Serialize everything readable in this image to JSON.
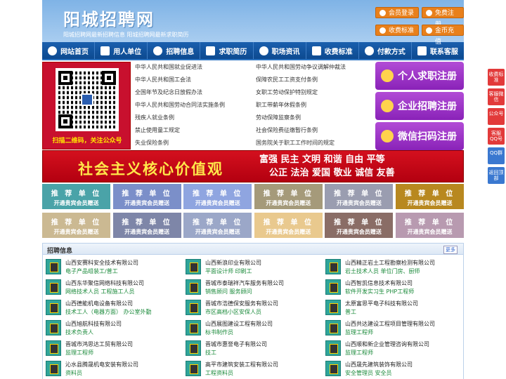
{
  "header": {
    "title": "阳城招聘网",
    "tagline": "阳城招聘网最新招聘信息   阳城招聘网最新求职简历",
    "buttons": [
      "会员登录",
      "免费注册",
      "收费标准",
      "金币充值"
    ]
  },
  "nav": {
    "items": [
      {
        "label": "网站首页",
        "icon": "home-icon"
      },
      {
        "label": "用人单位",
        "icon": "building-icon"
      },
      {
        "label": "招聘信息",
        "icon": "recruit-icon"
      },
      {
        "label": "求职简历",
        "icon": "resume-icon"
      },
      {
        "label": "职场资讯",
        "icon": "news-icon"
      },
      {
        "label": "收费标准",
        "icon": "fee-icon"
      },
      {
        "label": "付款方式",
        "icon": "payment-icon"
      },
      {
        "label": "联系客服",
        "icon": "service-icon"
      }
    ]
  },
  "qr": {
    "caption": "扫描二维码，关注公众号"
  },
  "laws": {
    "left": [
      "中华人民共和国就业促进法",
      "中华人民共和国工会法",
      "全国年节及纪念日放假办法",
      "中华人民共和国劳动合同法实施条例",
      "残疾人就业条例",
      "禁止使用童工规定",
      "失业保险条例"
    ],
    "right": [
      "中华人民共和国劳动争议调解仲裁法",
      "保障农民工工资支付条例",
      "女职工劳动保护特别规定",
      "职工带薪年休假条例",
      "劳动保障监察条例",
      "社会保险费征缴暂行条例",
      "国务院关于职工工作时间的规定"
    ]
  },
  "register": [
    "个人求职注册",
    "企业招聘注册",
    "微信扫码注册"
  ],
  "banner": {
    "main": "社会主义核心价值观",
    "line1": "富强  民主  文明  和谐  自由  平等",
    "line2": "公正  法治  爱国  敬业  诚信  友善"
  },
  "recommend": {
    "title": "推 荐 单 位",
    "sub": "开通贵宾会员赠送",
    "colors": [
      "#4aa3a8",
      "#7b8fc9",
      "#8fa5e0",
      "#a59a7a",
      "#9a9db0",
      "#b8881f",
      "#cbb992",
      "#7e86a8",
      "#9ba7c8",
      "#e9c98e",
      "#8a6d66",
      "#b89ab0"
    ]
  },
  "jobs": {
    "title": "招聘信息",
    "more": "更多",
    "items": [
      {
        "company": "山西安赛科安全技术有限公司",
        "positions": "电子产品组装工/普工"
      },
      {
        "company": "山西新浪印业有限公司",
        "positions": "平面设计师  印刷工"
      },
      {
        "company": "山西精正岩土工程勘察检测有限公司",
        "positions": "岩土技术人员  单位门房、厨师"
      },
      {
        "company": "山西东华聚信网络科技有限公司",
        "positions": "网络技术人员  工程施工人员"
      },
      {
        "company": "晋城市泰瑞祥汽车服务有限公司",
        "positions": "销售顾问  服务顾问"
      },
      {
        "company": "山西智凯信息技术有限公司",
        "positions": "软件开发实习生  PHP工程师"
      },
      {
        "company": "山西德能机电设备有限公司",
        "positions": "技术工人（电器方面）  办公室外勤"
      },
      {
        "company": "晋城市浩德保安服务有限公司",
        "positions": "市区高档小区安保人员"
      },
      {
        "company": "太原富思平电子科技有限公司",
        "positions": "普工"
      },
      {
        "company": "山西旭航科技有限公司",
        "positions": "技术负责人"
      },
      {
        "company": "山西展图建设工程有限公司",
        "positions": "标书制作员"
      },
      {
        "company": "山西共达建设工程项目管理有限公司",
        "positions": "监理工程师"
      },
      {
        "company": "晋城市鸿思达工贸有限公司",
        "positions": "监理工程师"
      },
      {
        "company": "晋城市惠誉电子有限公司",
        "positions": "技工"
      },
      {
        "company": "山西顺和新企业管理咨询有限公司",
        "positions": "监理工程师"
      },
      {
        "company": "沁水县腾晟机电安装有限公司",
        "positions": "资料员"
      },
      {
        "company": "高平市建筑安装工程有限公司",
        "positions": "工程资料员"
      },
      {
        "company": "山西晟先建筑装饰有限公司",
        "positions": "安全管理员  安全员"
      }
    ]
  },
  "right_tools": [
    "收费标准",
    "客服微信",
    "公众号",
    "客服QQ号",
    "QQ群",
    "返回顶部"
  ]
}
